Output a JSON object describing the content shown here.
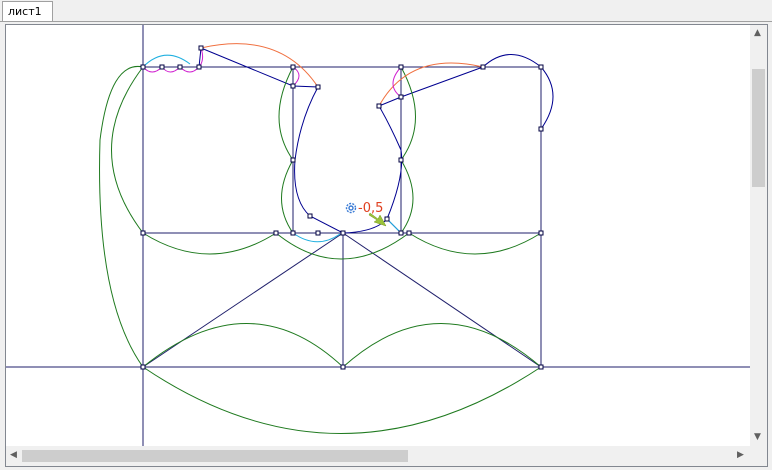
{
  "tabs": [
    {
      "label": "лист1"
    }
  ],
  "annotation": {
    "value": "-0,5",
    "color": "#e04020"
  },
  "colors": {
    "construction": "#1f1f6b",
    "contour": "#000090",
    "outer_curves": "#1f7a1f",
    "orange_arcs": "#f07040",
    "cyan_arcs": "#20b0e0",
    "magenta_arcs": "#d020d0",
    "arrow": "#9bc23a",
    "gear": "#3a7bd5"
  },
  "icons": {
    "gear": "gear-icon",
    "arrow": "pointer-arrow-icon"
  }
}
